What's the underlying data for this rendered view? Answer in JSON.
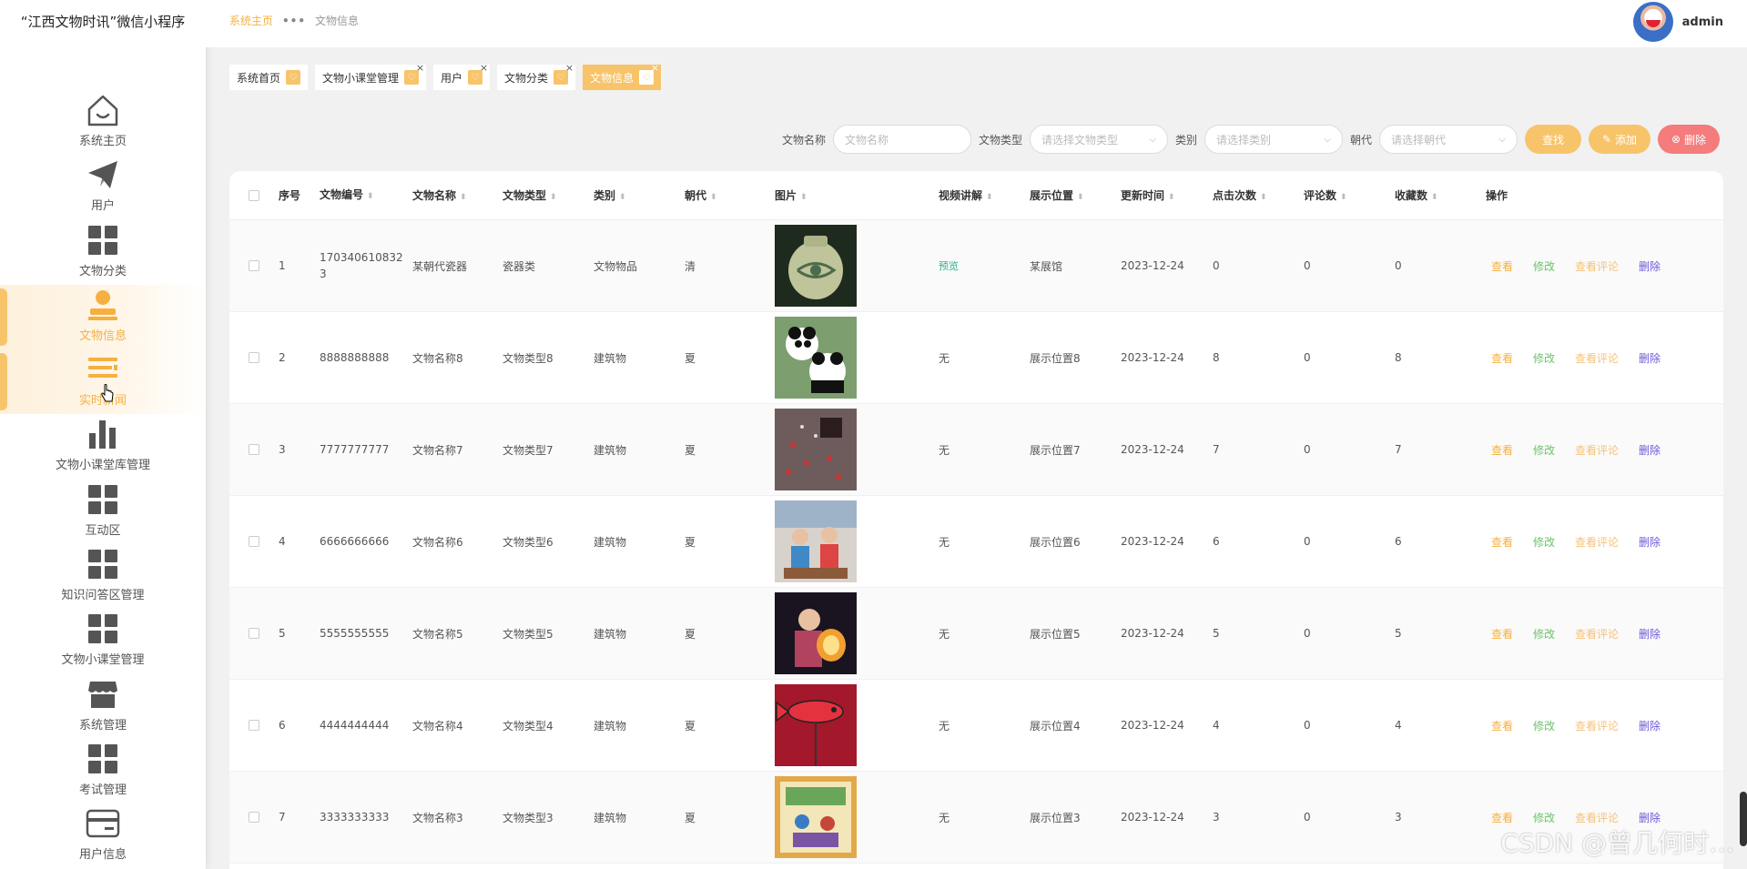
{
  "app": {
    "title": "“江西文物时讯”微信小程序"
  },
  "sidebar": {
    "items": [
      {
        "label": "系统主页",
        "icon": "home-icon"
      },
      {
        "label": "用户",
        "icon": "paper-plane-icon"
      },
      {
        "label": "文物分类",
        "icon": "grid-icon"
      },
      {
        "label": "文物信息",
        "icon": "user-stamp-icon"
      },
      {
        "label": "实时新闻",
        "icon": "list-icon"
      },
      {
        "label": "文物小课堂库管理",
        "icon": "bar-chart-icon"
      },
      {
        "label": "互动区",
        "icon": "grid-icon"
      },
      {
        "label": "知识问答区管理",
        "icon": "grid-icon"
      },
      {
        "label": "文物小课堂管理",
        "icon": "grid-icon"
      },
      {
        "label": "系统管理",
        "icon": "store-icon"
      },
      {
        "label": "考试管理",
        "icon": "grid-icon"
      },
      {
        "label": "用户信息",
        "icon": "card-icon"
      }
    ]
  },
  "topbar": {
    "breadcrumb_home": "系统主页",
    "breadcrumb_current": "文物信息",
    "username": "admin"
  },
  "tags": [
    {
      "label": "系统首页",
      "closable": false,
      "active": false
    },
    {
      "label": "文物小课堂管理",
      "closable": true,
      "active": false
    },
    {
      "label": "用户",
      "closable": true,
      "active": false
    },
    {
      "label": "文物分类",
      "closable": true,
      "active": false
    },
    {
      "label": "文物信息",
      "closable": true,
      "active": true
    }
  ],
  "search": {
    "name_label": "文物名称",
    "name_placeholder": "文物名称",
    "type_label": "文物类型",
    "type_placeholder": "请选择文物类型",
    "category_label": "类别",
    "category_placeholder": "请选择类别",
    "dynasty_label": "朝代",
    "dynasty_placeholder": "请选择朝代",
    "find_label": "查找",
    "add_label": "添加",
    "delete_label": "删除"
  },
  "table": {
    "columns": [
      "序号",
      "文物编号",
      "文物名称",
      "文物类型",
      "类别",
      "朝代",
      "图片",
      "视频讲解",
      "展示位置",
      "更新时间",
      "点击次数",
      "评论数",
      "收藏数",
      "操作"
    ],
    "op_labels": {
      "view": "查看",
      "edit": "修改",
      "comments": "查看评论",
      "delete": "删除"
    },
    "rows": [
      {
        "no": "1",
        "code": "1703406108323",
        "name": "某朝代瓷器",
        "type": "瓷器类",
        "category": "文物物品",
        "dynasty": "清",
        "video": "预览",
        "position": "某展馆",
        "time": "2023-12-24",
        "clicks": "0",
        "comments": "0",
        "favs": "0",
        "img": "vase"
      },
      {
        "no": "2",
        "code": "8888888888",
        "name": "文物名称8",
        "type": "文物类型8",
        "category": "建筑物",
        "dynasty": "夏",
        "video": "无",
        "position": "展示位置8",
        "time": "2023-12-24",
        "clicks": "8",
        "comments": "0",
        "favs": "8",
        "img": "panda"
      },
      {
        "no": "3",
        "code": "7777777777",
        "name": "文物名称7",
        "type": "文物类型7",
        "category": "建筑物",
        "dynasty": "夏",
        "video": "无",
        "position": "展示位置7",
        "time": "2023-12-24",
        "clicks": "7",
        "comments": "0",
        "favs": "7",
        "img": "petals"
      },
      {
        "no": "4",
        "code": "6666666666",
        "name": "文物名称6",
        "type": "文物类型6",
        "category": "建筑物",
        "dynasty": "夏",
        "video": "无",
        "position": "展示位置6",
        "time": "2023-12-24",
        "clicks": "6",
        "comments": "0",
        "favs": "6",
        "img": "kids"
      },
      {
        "no": "5",
        "code": "5555555555",
        "name": "文物名称5",
        "type": "文物类型5",
        "category": "建筑物",
        "dynasty": "夏",
        "video": "无",
        "position": "展示位置5",
        "time": "2023-12-24",
        "clicks": "5",
        "comments": "0",
        "favs": "5",
        "img": "lantern"
      },
      {
        "no": "6",
        "code": "4444444444",
        "name": "文物名称4",
        "type": "文物类型4",
        "category": "建筑物",
        "dynasty": "夏",
        "video": "无",
        "position": "展示位置4",
        "time": "2023-12-24",
        "clicks": "4",
        "comments": "0",
        "favs": "4",
        "img": "fish"
      },
      {
        "no": "7",
        "code": "3333333333",
        "name": "文物名称3",
        "type": "文物类型3",
        "category": "建筑物",
        "dynasty": "夏",
        "video": "无",
        "position": "展示位置3",
        "time": "2023-12-24",
        "clicks": "3",
        "comments": "0",
        "favs": "3",
        "img": "painting"
      }
    ]
  },
  "watermark": "CSDN @曾几何时…",
  "colors": {
    "accent": "#f8c46a",
    "danger": "#f47c7c",
    "edit": "#6cc36c",
    "delete_link": "#6b5bd6",
    "preview": "#2bb08a"
  }
}
